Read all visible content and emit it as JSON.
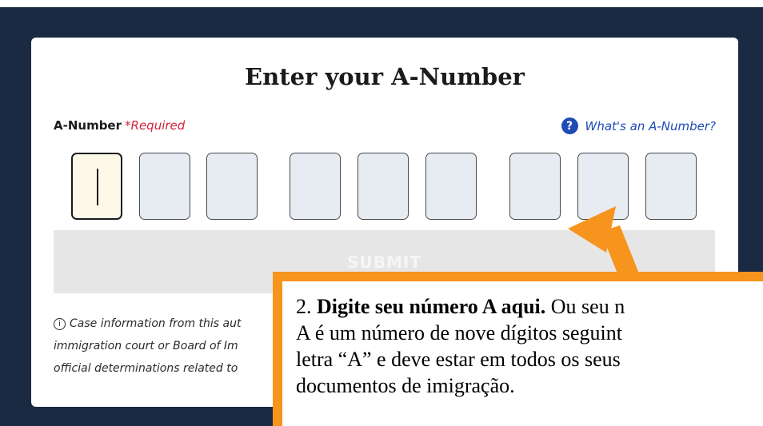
{
  "form": {
    "title": "Enter your A-Number",
    "field_label": "A-Number",
    "required_label": "*Required",
    "help_link_icon": "question-circle-icon",
    "help_link_icon_glyph": "?",
    "help_link_text": "What's an A-Number?",
    "digit_count": 9,
    "active_digit_index": 0,
    "submit_label": "SUBMIT",
    "disclaimer_icon": "info-circle-icon",
    "disclaimer_icon_glyph": "i",
    "disclaimer_lines": [
      "Case information from this aut",
      "immigration court or Board of Im",
      "official determinations related to"
    ]
  },
  "annotation": {
    "step_number": "2.",
    "bold_text": "Digite seu número A aqui.",
    "lines": [
      " Ou seu n",
      "A é um número de nove dígitos seguint",
      "letra “A” e deve estar em todos os seus",
      "documentos de imigração."
    ],
    "arrow_color": "#f7941d",
    "box_border_color": "#f7941d"
  },
  "colors": {
    "background": "#1b2a43",
    "card": "#ffffff",
    "required": "#d0243d",
    "link": "#1f4bb5",
    "digit_fill": "#e7ecf3",
    "active_digit_fill": "#fdf9e9",
    "submit_disabled": "#e6e6e6"
  }
}
